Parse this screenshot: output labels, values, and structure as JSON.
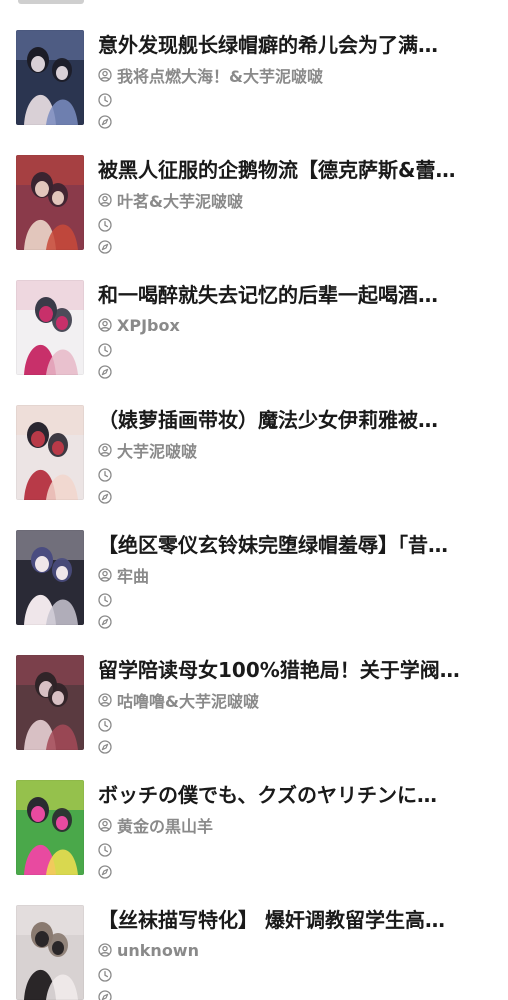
{
  "items": [
    {
      "title": "意外发现舰长绿帽癖的希儿会为了满…",
      "author": "我将点燃大海！&大芋泥啵啵",
      "palette": [
        "#2b3550",
        "#d9d0d6",
        "#1c1c26",
        "#7a8cc0"
      ]
    },
    {
      "title": "被黑人征服的企鹅物流【德克萨斯&蕾…",
      "author": "叶茗&大芋泥啵啵",
      "palette": [
        "#8a3a4a",
        "#e2c6bc",
        "#3a2430",
        "#c84a3a"
      ]
    },
    {
      "title": "和一喝醉就失去记忆的后辈一起喝酒…",
      "author": "XPJbox",
      "palette": [
        "#f2f0f2",
        "#c8306a",
        "#3a3a48",
        "#e8b8c8"
      ]
    },
    {
      "title": "（婊萝插画带妆）魔法少女伊莉雅被…",
      "author": "大芋泥啵啵",
      "palette": [
        "#ece4e4",
        "#b83a48",
        "#2a2630",
        "#f2d6cc"
      ]
    },
    {
      "title": "【绝区零仪玄铃妹完堕绿帽羞辱】「昔…",
      "author": "牢曲",
      "palette": [
        "#2a2a36",
        "#efe6ea",
        "#4a4c80",
        "#c8c4d0"
      ]
    },
    {
      "title": "留学陪读母女100%猎艳局！关于学阀…",
      "author": "咕噜噜&大芋泥啵啵",
      "palette": [
        "#5a3a40",
        "#d8c0c4",
        "#302428",
        "#a44a58"
      ]
    },
    {
      "title": "ボッチの僕でも、クズのヤリチンに…",
      "author": "黄金の黒山羊",
      "palette": [
        "#4aa84a",
        "#e84aa0",
        "#2a2a30",
        "#f2e050"
      ]
    },
    {
      "title": "【丝袜描写特化】 爆奸调教留学生高…",
      "author": "unknown",
      "palette": [
        "#d8d2d2",
        "#2a2628",
        "#8a7a70",
        "#f2ecec"
      ]
    }
  ]
}
